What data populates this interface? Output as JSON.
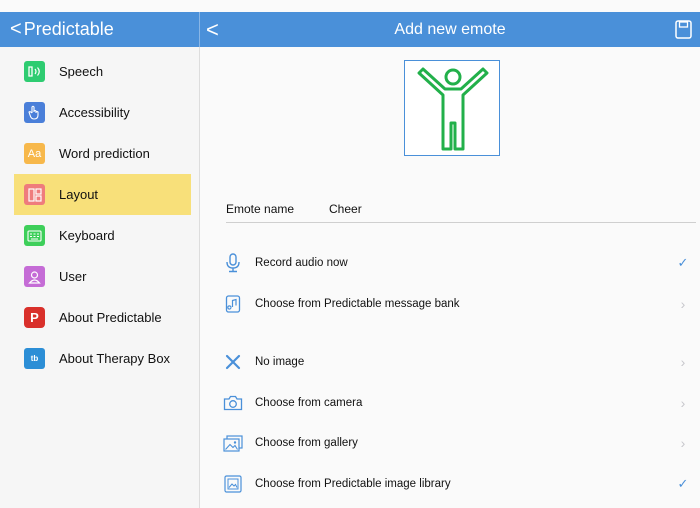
{
  "app_bar": {
    "back_label": "Predictable",
    "back_chevron": "<",
    "detail_back": "<",
    "title": "Add new emote"
  },
  "sidebar": {
    "items": [
      {
        "label": "Speech",
        "icon": "speech-icon",
        "color": "#2ecc71",
        "glyph": ")"
      },
      {
        "label": "Accessibility",
        "icon": "hand-icon",
        "color": "#4a7fd9",
        "glyph": "☝"
      },
      {
        "label": "Word prediction",
        "icon": "text-aa-icon",
        "color": "#f7b84b",
        "glyph": "Aa"
      },
      {
        "label": "Layout",
        "icon": "layout-icon",
        "color": "#ef7c7c",
        "glyph": "▤"
      },
      {
        "label": "Keyboard",
        "icon": "keyboard-icon",
        "color": "#3ecf5a",
        "glyph": "⌨"
      },
      {
        "label": "User",
        "icon": "user-icon",
        "color": "#c56cd6",
        "glyph": "☺"
      },
      {
        "label": "About Predictable",
        "icon": "predictable-logo-icon",
        "color": "#d9302b",
        "glyph": "P"
      },
      {
        "label": "About Therapy Box",
        "icon": "therapy-box-logo-icon",
        "color": "#2c8ed6",
        "glyph": "tb"
      }
    ],
    "active_index": 3
  },
  "form": {
    "name_label": "Emote name",
    "name_value": "Cheer"
  },
  "audio_options": [
    {
      "label": "Record audio now",
      "trailing": "✓",
      "selected": true
    },
    {
      "label": "Choose from Predictable message bank",
      "trailing": "›",
      "selected": false
    }
  ],
  "image_options": [
    {
      "label": "No image",
      "trailing": "›",
      "selected": false
    },
    {
      "label": "Choose from camera",
      "trailing": "›",
      "selected": false
    },
    {
      "label": "Choose from gallery",
      "trailing": "›",
      "selected": false
    },
    {
      "label": "Choose from Predictable image library",
      "trailing": "✓",
      "selected": true
    }
  ],
  "colors": {
    "accent": "#4a90d9",
    "active_row": "#f8e07a",
    "emote_figure": "#22b04a"
  }
}
